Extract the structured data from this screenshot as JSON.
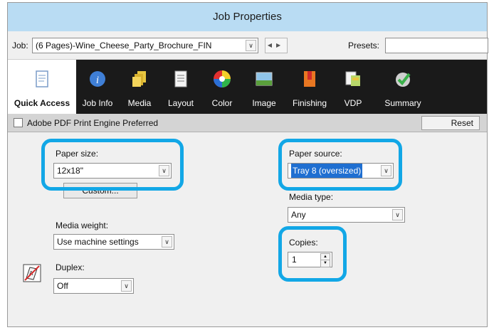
{
  "window": {
    "title": "Job Properties"
  },
  "job": {
    "label": "Job:",
    "value": "(6 Pages)-Wine_Cheese_Party_Brochure_FIN",
    "presets_label": "Presets:",
    "presets_value": ""
  },
  "tabs": [
    {
      "label": "Quick Access",
      "icon": "quick-access-icon"
    },
    {
      "label": "Job Info",
      "icon": "info-icon"
    },
    {
      "label": "Media",
      "icon": "media-icon"
    },
    {
      "label": "Layout",
      "icon": "layout-icon"
    },
    {
      "label": "Color",
      "icon": "color-wheel-icon"
    },
    {
      "label": "Image",
      "icon": "image-icon"
    },
    {
      "label": "Finishing",
      "icon": "finishing-icon"
    },
    {
      "label": "VDP",
      "icon": "vdp-icon"
    },
    {
      "label": "Summary",
      "icon": "summary-check-icon"
    }
  ],
  "options": {
    "pdf_engine_label": "Adobe PDF Print Engine Preferred",
    "pdf_engine_checked": false,
    "reset_label": "Reset"
  },
  "fields": {
    "paper_size": {
      "label": "Paper size:",
      "value": "12x18\""
    },
    "custom_button": "Custom...",
    "media_weight": {
      "label": "Media weight:",
      "value": "Use machine settings"
    },
    "duplex": {
      "label": "Duplex:",
      "value": "Off"
    },
    "paper_source": {
      "label": "Paper source:",
      "value": "Tray 8 (oversized)"
    },
    "media_type": {
      "label": "Media type:",
      "value": "Any"
    },
    "copies": {
      "label": "Copies:",
      "value": "1"
    }
  },
  "colors": {
    "titlebar": "#b9dcf3",
    "highlight": "#12a7e6",
    "toolbar": "#1a1a1a",
    "selection": "#1f6fd1"
  }
}
